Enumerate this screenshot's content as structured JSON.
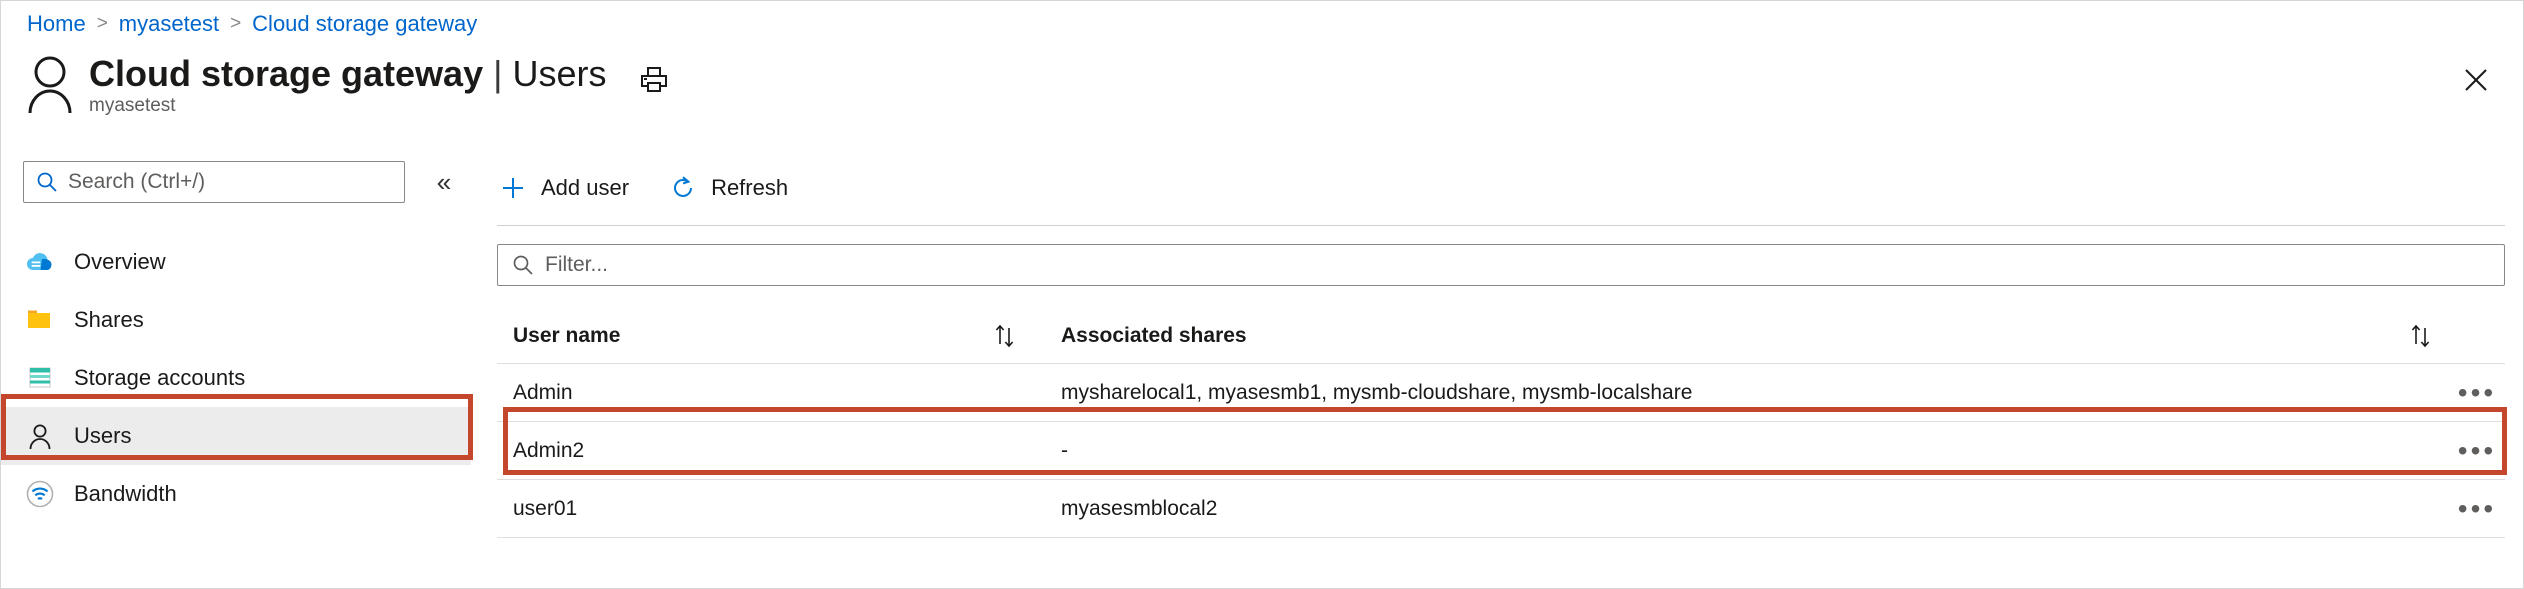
{
  "breadcrumb": {
    "items": [
      "Home",
      "myasetest",
      "Cloud storage gateway"
    ],
    "separator": ">"
  },
  "header": {
    "avatar_icon": "person-icon",
    "title_resource": "Cloud storage gateway",
    "title_separator": "|",
    "title_page": "Users",
    "subtitle": "myasetest",
    "print_icon": "printer-icon",
    "close_icon": "close-icon"
  },
  "sidebar": {
    "search": {
      "placeholder": "Search (Ctrl+/)",
      "value": "",
      "icon": "search-icon"
    },
    "collapse_icon": "chevron-double-left-icon",
    "collapse_label": "«",
    "items": [
      {
        "label": "Overview",
        "icon": "cloud-icon",
        "selected": false
      },
      {
        "label": "Shares",
        "icon": "folder-icon",
        "selected": false
      },
      {
        "label": "Storage accounts",
        "icon": "storage-account-icon",
        "selected": false
      },
      {
        "label": "Users",
        "icon": "person-icon",
        "selected": true
      },
      {
        "label": "Bandwidth",
        "icon": "bandwidth-icon",
        "selected": false
      }
    ]
  },
  "toolbar": {
    "add_user_label": "Add user",
    "add_user_icon": "plus-icon",
    "refresh_label": "Refresh",
    "refresh_icon": "refresh-icon"
  },
  "filter": {
    "placeholder": "Filter...",
    "value": "",
    "icon": "search-icon"
  },
  "table": {
    "columns": [
      {
        "label": "User name",
        "sortable": true,
        "sort_icon": "sort-updown-icon"
      },
      {
        "label": "Associated shares",
        "sortable": true,
        "sort_icon": "sort-updown-icon"
      }
    ],
    "row_menu_icon": "more-actions-icon",
    "rows": [
      {
        "user_name": "Admin",
        "associated_shares": "mysharelocal1, myasesmb1, mysmb-cloudshare, mysmb-localshare",
        "highlighted": false
      },
      {
        "user_name": "Admin2",
        "associated_shares": "-",
        "highlighted": true
      },
      {
        "user_name": "user01",
        "associated_shares": "myasesmblocal2",
        "highlighted": false
      }
    ]
  },
  "annotations": {
    "highlight_color": "#c4472d",
    "highlight_targets": [
      "sidebar-item-users",
      "table-row-admin2"
    ]
  },
  "colors": {
    "link": "#0066cc",
    "accent_icon": "#0078d4",
    "selected_nav_bg": "#ececec",
    "divider": "#e1dfdd",
    "text_primary": "#1b1a19",
    "text_secondary": "#605e5c"
  }
}
